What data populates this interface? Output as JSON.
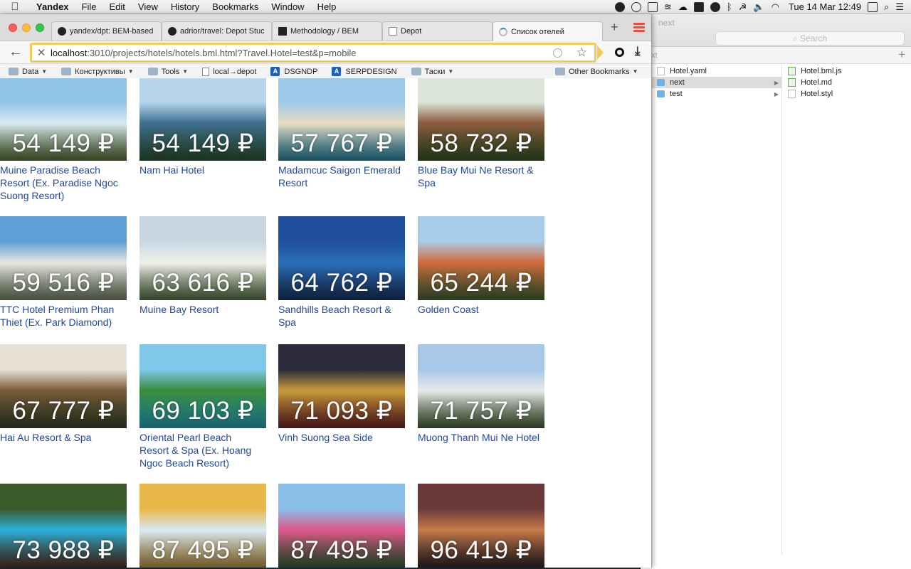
{
  "menubar": {
    "app": "Yandex",
    "items": [
      "File",
      "Edit",
      "View",
      "History",
      "Bookmarks",
      "Window",
      "Help"
    ],
    "clock": "Tue 14 Mar  12:49"
  },
  "tabs": [
    {
      "label": "yandex/dpt: BEM-based",
      "icon": "github-icon"
    },
    {
      "label": "adrior/travel: Depot Stuc",
      "icon": "github-icon"
    },
    {
      "label": "Methodology / BEM",
      "icon": "bem-icon"
    },
    {
      "label": "Depot",
      "icon": "page-icon"
    },
    {
      "label": "Список отелей",
      "icon": "loading-icon"
    }
  ],
  "address": {
    "host": "localhost",
    "path": ":3010/projects/hotels/hotels.bml.html?Travel.Hotel=test&p=mobile"
  },
  "bookmarks": [
    {
      "label": "Data",
      "type": "folder",
      "caret": true
    },
    {
      "label": "Конструктивы",
      "type": "folder",
      "caret": true
    },
    {
      "label": "Tools",
      "type": "folder",
      "caret": true
    },
    {
      "label": "local→depot",
      "type": "page",
      "caret": false
    },
    {
      "label": "DSGNDP",
      "type": "yandex",
      "caret": false
    },
    {
      "label": "SERPDESIGN",
      "type": "yandex",
      "caret": false
    },
    {
      "label": "Таски",
      "type": "folder",
      "caret": true
    }
  ],
  "other_bookmarks": "Other Bookmarks",
  "hotels": [
    {
      "price": "54 149 ₽",
      "name": "Muine Paradise Beach Resort (Ex. Paradise Ngoc Suong Resort)",
      "colors": [
        "#8fc3e8",
        "#d9e8f2",
        "#5b7a3a"
      ]
    },
    {
      "price": "54 149 ₽",
      "name": "Nam Hai Hotel",
      "colors": [
        "#b7d6ee",
        "#3f6f8f",
        "#2f5a3a"
      ]
    },
    {
      "price": "57 767 ₽",
      "name": "Madamcuc Saigon Emerald Resort",
      "colors": [
        "#9ec9e8",
        "#e8dcc0",
        "#2a8fb0"
      ]
    },
    {
      "price": "58 732 ₽",
      "name": "Blue Bay Mui Ne Resort & Spa",
      "colors": [
        "#dbe6d8",
        "#8a5a3c",
        "#3a5a2a"
      ]
    },
    {
      "price": "59 516 ₽",
      "name": "TTC Hotel Premium Phan Thiet (Ex. Park Diamond)",
      "colors": [
        "#5f9ed6",
        "#e6e6e0",
        "#7a8a6a"
      ]
    },
    {
      "price": "63 616 ₽",
      "name": "Muine Bay Resort",
      "colors": [
        "#c8d6e2",
        "#f0f0ea",
        "#5a7a4a"
      ]
    },
    {
      "price": "64 762 ₽",
      "name": "Sandhills Beach Resort & Spa",
      "colors": [
        "#1f4f9e",
        "#2a6fb8",
        "#1c3a6a"
      ]
    },
    {
      "price": "65 244 ₽",
      "name": "Golden Coast",
      "colors": [
        "#a8cce8",
        "#d26a3a",
        "#4a6a3a"
      ]
    },
    {
      "price": "67 777 ₽",
      "name": "Hai Au Resort & Spa",
      "colors": [
        "#e8e2d6",
        "#7a5a3a",
        "#3a4a2a"
      ]
    },
    {
      "price": "69 103 ₽",
      "name": "Oriental Pearl Beach Resort & Spa (Ex. Hoang Ngoc Beach Resort)",
      "colors": [
        "#7fc8ea",
        "#3a8a3a",
        "#2ab0c8"
      ]
    },
    {
      "price": "71 093 ₽",
      "name": "Vinh Suong Sea Side",
      "colors": [
        "#2a2a3a",
        "#c89a3a",
        "#7a2a2a"
      ]
    },
    {
      "price": "71 757 ₽",
      "name": "Muong Thanh Mui Ne Hotel",
      "colors": [
        "#a8c8e8",
        "#e8e8ea",
        "#4a6a3a"
      ]
    },
    {
      "price": "73 988 ₽",
      "name": "",
      "colors": [
        "#3a5a2a",
        "#2ab0d8",
        "#5a3a2a"
      ]
    },
    {
      "price": "87 495 ₽",
      "name": "",
      "colors": [
        "#e8b84a",
        "#d8e8f2",
        "#c8a04a"
      ]
    },
    {
      "price": "87 495 ₽",
      "name": "",
      "colors": [
        "#8ac0ea",
        "#e0568a",
        "#3a6a3a"
      ]
    },
    {
      "price": "96 419 ₽",
      "name": "",
      "colors": [
        "#6a3a3a",
        "#c87a4a",
        "#3a2a2a"
      ]
    }
  ],
  "finder": {
    "title": "next",
    "search_placeholder": "Search",
    "path_label": "ext",
    "col1": [
      {
        "label": "Hotel.yaml",
        "kind": "doc",
        "selected": false,
        "arrow": false
      },
      {
        "label": "next",
        "kind": "folder",
        "selected": true,
        "arrow": true
      },
      {
        "label": "test",
        "kind": "folder",
        "selected": false,
        "arrow": true
      }
    ],
    "col2": [
      {
        "label": "Hotel.bml.js",
        "kind": "js"
      },
      {
        "label": "Hotel.md",
        "kind": "js"
      },
      {
        "label": "Hotel.styl",
        "kind": "doc"
      }
    ]
  }
}
